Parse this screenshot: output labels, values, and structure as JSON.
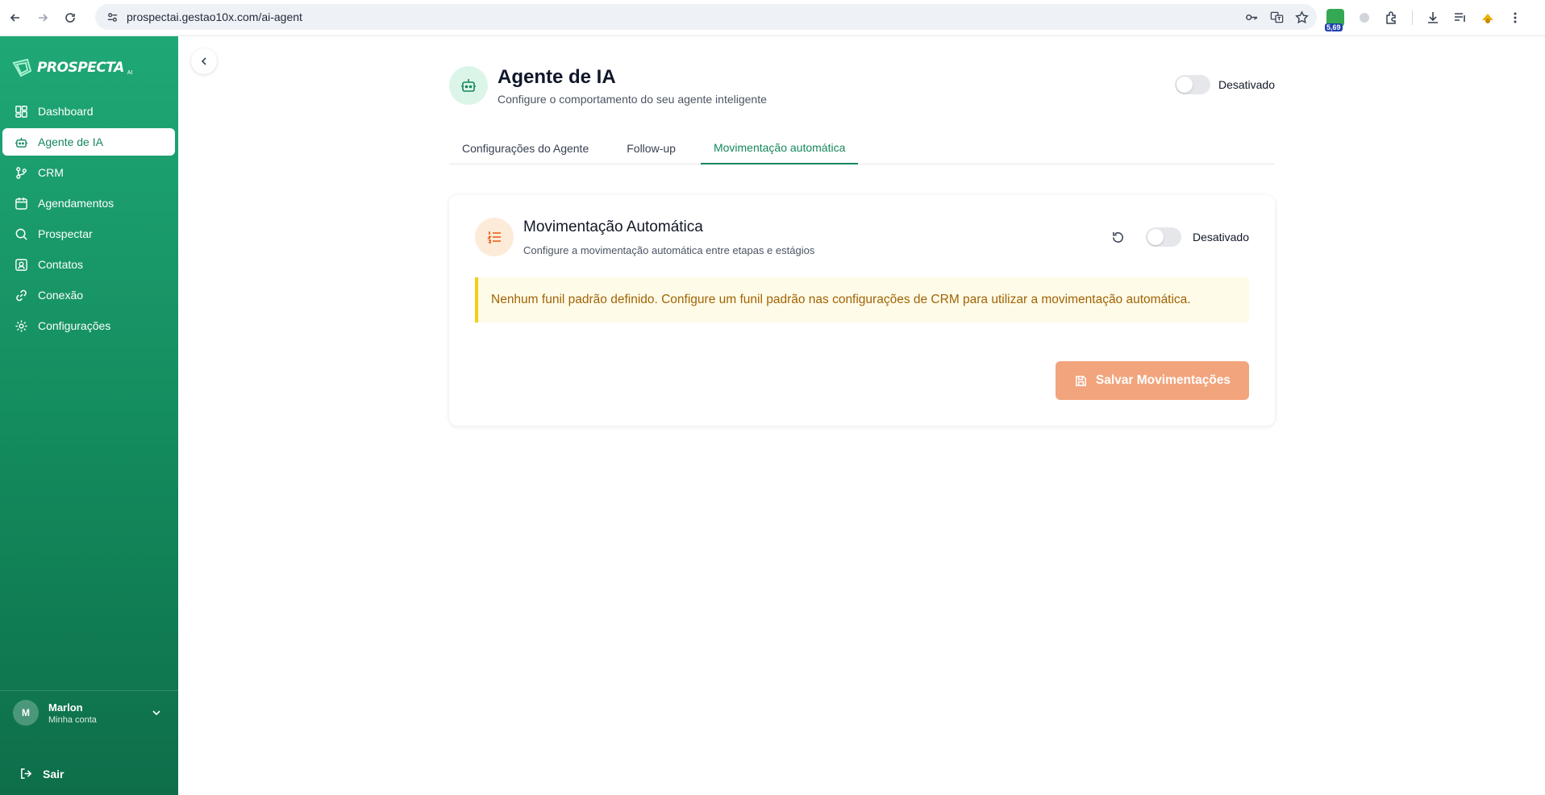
{
  "browser": {
    "url": "prospectai.gestao10x.com/ai-agent",
    "extension_badge": "5,69"
  },
  "sidebar": {
    "logo_text": "PROSPECTA",
    "logo_sub": "AI",
    "items": [
      {
        "label": "Dashboard",
        "icon": "dashboard-icon"
      },
      {
        "label": "Agente de IA",
        "icon": "bot-icon"
      },
      {
        "label": "CRM",
        "icon": "git-branch-icon"
      },
      {
        "label": "Agendamentos",
        "icon": "calendar-icon"
      },
      {
        "label": "Prospectar",
        "icon": "search-icon"
      },
      {
        "label": "Contatos",
        "icon": "contact-icon"
      },
      {
        "label": "Conexão",
        "icon": "link-icon"
      },
      {
        "label": "Configurações",
        "icon": "gear-icon"
      }
    ],
    "active_item": "Agente de IA",
    "user": {
      "initial": "M",
      "name": "Marlon",
      "subtitle": "Minha conta"
    },
    "logout_label": "Sair"
  },
  "header": {
    "title": "Agente de IA",
    "subtitle": "Configure o comportamento do seu agente inteligente",
    "toggle_label": "Desativado",
    "toggle_on": false
  },
  "tabs": [
    {
      "label": "Configurações do Agente",
      "active": false
    },
    {
      "label": "Follow-up",
      "active": false
    },
    {
      "label": "Movimentação automática",
      "active": true
    }
  ],
  "card": {
    "title": "Movimentação Automática",
    "subtitle": "Configure a movimentação automática entre etapas e estágios",
    "toggle_label": "Desativado",
    "toggle_on": false,
    "alert": "Nenhum funil padrão definido. Configure um funil padrão nas configurações de CRM para utilizar a movimentação automática.",
    "save_label": "Salvar Movimentações"
  },
  "colors": {
    "brand_green": "#15875c",
    "accent_orange": "#f2a47c",
    "alert_bg": "#fefce8",
    "alert_border": "#facc15",
    "alert_text": "#a16207"
  }
}
